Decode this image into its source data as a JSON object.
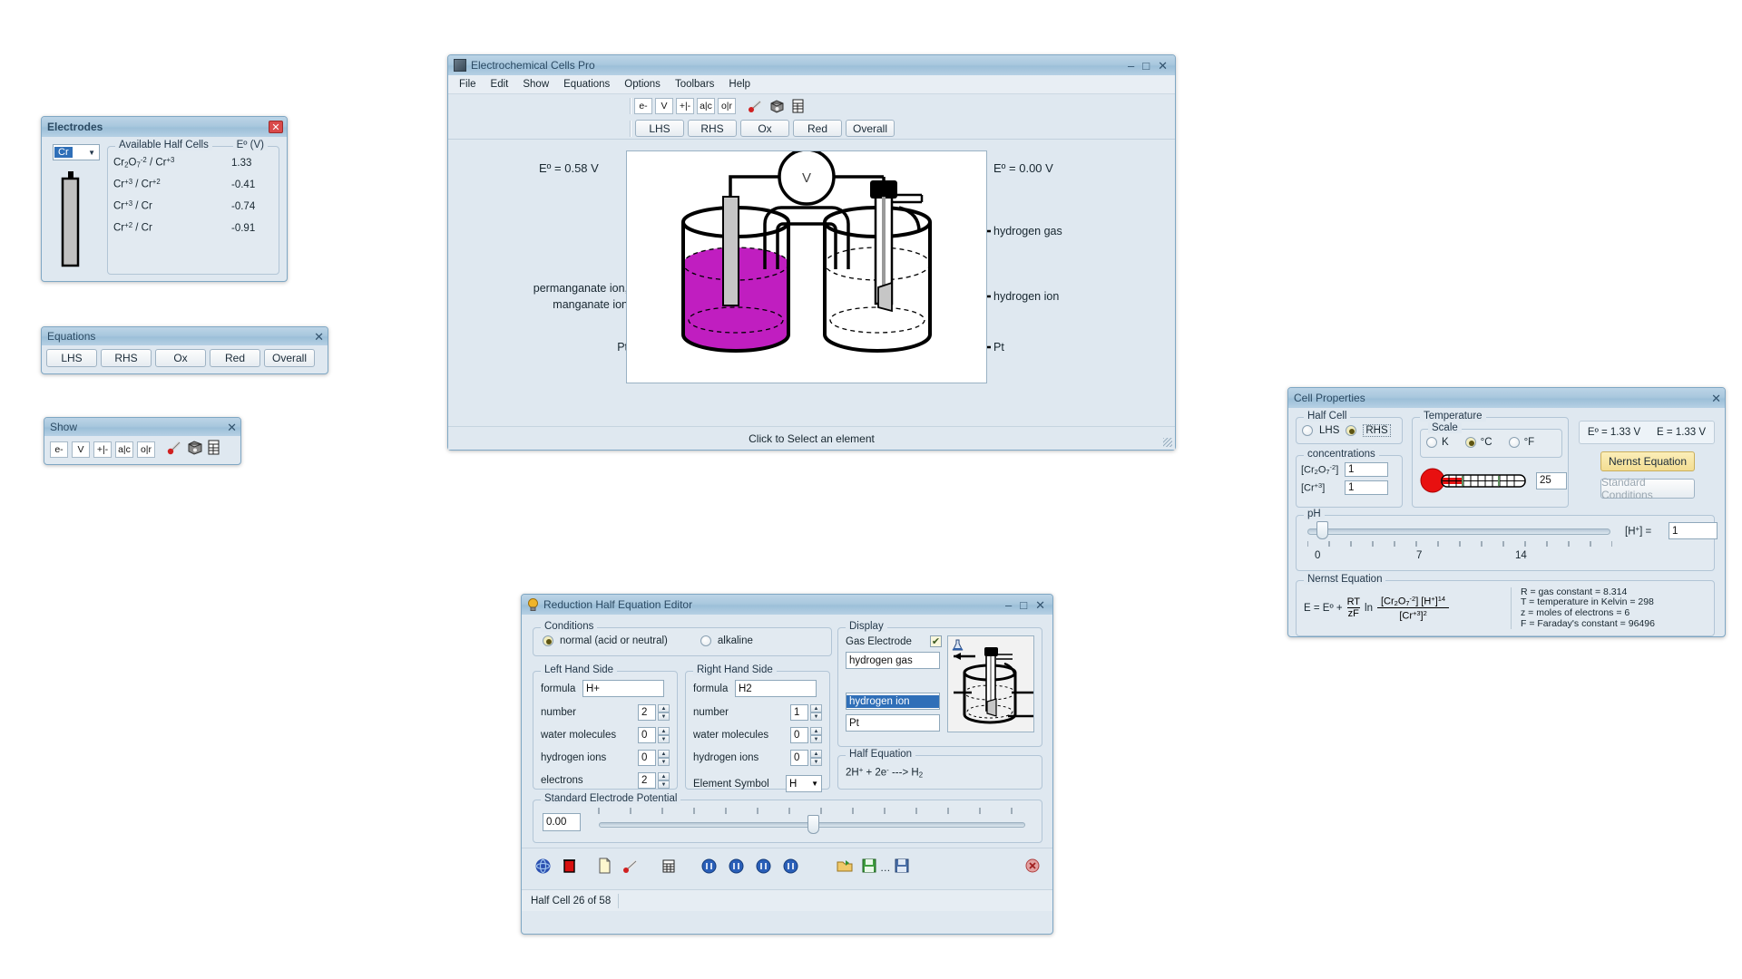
{
  "main_window": {
    "title": "Electrochemical Cells Pro",
    "icon": "app-icon",
    "min_label": "–",
    "max_label": "□",
    "close_label": "✕",
    "menu": [
      "File",
      "Edit",
      "Show",
      "Equations",
      "Options",
      "Toolbars",
      "Help"
    ],
    "show_toolbar_icons": [
      "e-",
      "V",
      "+|-",
      "a|c",
      "o|r",
      "thermometer-icon",
      "cube-icon",
      "table-icon"
    ],
    "equation_tabs": [
      "LHS",
      "RHS",
      "Ox",
      "Red",
      "Overall"
    ],
    "status": "Click to Select an element",
    "diagram": {
      "left_potential": "Eº = 0.58 V",
      "right_potential": "Eº = 0.00 V",
      "left_labels": [
        "permanganate ion,",
        "manganate ion",
        "Pt"
      ],
      "right_labels": [
        "hydrogen gas",
        "hydrogen ion",
        "Pt"
      ],
      "voltmeter": "V",
      "solution_color": "#c01ec0"
    }
  },
  "electrodes_window": {
    "title": "Electrodes",
    "close_label": "✕",
    "element_select": "Cr",
    "group_label_left": "Available Half Cells",
    "group_label_right": "Eº (V)",
    "half_cells": [
      {
        "formula_html": "Cr<sub>2</sub>O<sub>7</sub><sup>-2</sup> / Cr<sup>+3</sup>",
        "value": "1.33"
      },
      {
        "formula_html": "Cr<sup>+3</sup> / Cr<sup>+2</sup>",
        "value": "-0.41"
      },
      {
        "formula_html": "Cr<sup>+3</sup> / Cr",
        "value": "-0.74"
      },
      {
        "formula_html": "Cr<sup>+2</sup> / Cr",
        "value": "-0.91"
      }
    ]
  },
  "equations_window": {
    "title": "Equations",
    "close_label": "✕",
    "buttons": [
      "LHS",
      "RHS",
      "Ox",
      "Red",
      "Overall"
    ]
  },
  "show_window": {
    "title": "Show",
    "close_label": "✕",
    "buttons": [
      "e-",
      "V",
      "+|-",
      "a|c",
      "o|r"
    ],
    "icons": [
      "thermometer-icon",
      "cube-icon",
      "table-icon"
    ]
  },
  "cell_properties": {
    "title": "Cell Properties",
    "close_label": "✕",
    "half_cell": {
      "label": "Half Cell",
      "options": [
        "LHS",
        "RHS"
      ],
      "selected": "RHS"
    },
    "concentrations": {
      "label": "concentrations",
      "rows": [
        {
          "species_html": "[Cr<sub>2</sub>O<sub>7</sub><sup>-2</sup>]",
          "value": "1"
        },
        {
          "species_html": "[Cr<sup>+3</sup>]",
          "value": "1"
        }
      ]
    },
    "temperature": {
      "label": "Temperature",
      "scale_label": "Scale",
      "scales": [
        "K",
        "°C",
        "°F"
      ],
      "selected_scale": "°C",
      "value": "25"
    },
    "ph": {
      "label": "pH",
      "ticks": [
        "0",
        "7",
        "14"
      ],
      "h_label_html": "[H<sup>+</sup>] =",
      "h_value": "1",
      "slider_pos_pct": 2
    },
    "readout": {
      "e_standard": "Eº = 1.33 V",
      "e_actual": "E  = 1.33 V"
    },
    "nernst_button": "Nernst Equation",
    "standard_button": "Standard Conditions",
    "nernst": {
      "label": "Nernst Equation",
      "lhs": "E = Eº +",
      "frac_top": "RT",
      "frac_bottom": "zF",
      "ln": "ln",
      "quotient_top_html": "[Cr<sub>2</sub>O<sub>7</sub><sup>-2</sup>] [H<sup>+</sup>]<sup>14</sup>",
      "quotient_bottom_html": "[Cr<sup>+3</sup>]<sup>2</sup>",
      "constants": [
        "R = gas constant = 8.314",
        "T = temperature in Kelvin = 298",
        "z = moles of electrons = 6",
        "F = Faraday's constant = 96496"
      ]
    }
  },
  "reduction_editor": {
    "title": "Reduction Half Equation Editor",
    "icon": "bulb-icon",
    "min_label": "–",
    "max_label": "□",
    "close_label": "✕",
    "conditions": {
      "label": "Conditions",
      "options": [
        "normal (acid or neutral)",
        "alkaline"
      ],
      "selected": "normal (acid or neutral)"
    },
    "lhs": {
      "label": "Left Hand Side",
      "formula_label": "formula",
      "formula": "H+",
      "fields": [
        {
          "label": "number",
          "value": "2"
        },
        {
          "label": "water molecules",
          "value": "0"
        },
        {
          "label": "hydrogen ions",
          "value": "0"
        },
        {
          "label": "electrons",
          "value": "2"
        }
      ]
    },
    "rhs": {
      "label": "Right Hand Side",
      "formula_label": "formula",
      "formula": "H2",
      "fields": [
        {
          "label": "number",
          "value": "1"
        },
        {
          "label": "water molecules",
          "value": "0"
        },
        {
          "label": "hydrogen ions",
          "value": "0"
        }
      ],
      "element_symbol_label": "Element Symbol",
      "element_symbol": "H"
    },
    "display": {
      "label": "Display",
      "gas_electrode_label": "Gas Electrode",
      "gas_electrode_checked": true,
      "check_glyph": "✔",
      "top_field": "hydrogen gas",
      "middle_field": "hydrogen ion",
      "bottom_field": "Pt",
      "preview_icon": "flask-icon"
    },
    "half_equation": {
      "label": "Half Equation",
      "text_html": "2H<sup>+</sup> + 2e<sup>-</sup> ---> H<sub>2</sub>"
    },
    "standard_potential": {
      "label": "Standard Electrode Potential",
      "value": "0.00",
      "slider_pos_pct": 54
    },
    "toolbar_icons": [
      "atom-icon",
      "beaker-icon",
      "new-document-icon",
      "pencil-icon",
      "table-icon",
      "nav-first-icon",
      "nav-prev-icon",
      "nav-next-icon",
      "nav-last-icon",
      "open-folder-icon",
      "save-icon",
      "save-ellipsis-icon",
      "save-disk-icon",
      "delete-icon"
    ],
    "status": "Half Cell 26 of 58"
  }
}
